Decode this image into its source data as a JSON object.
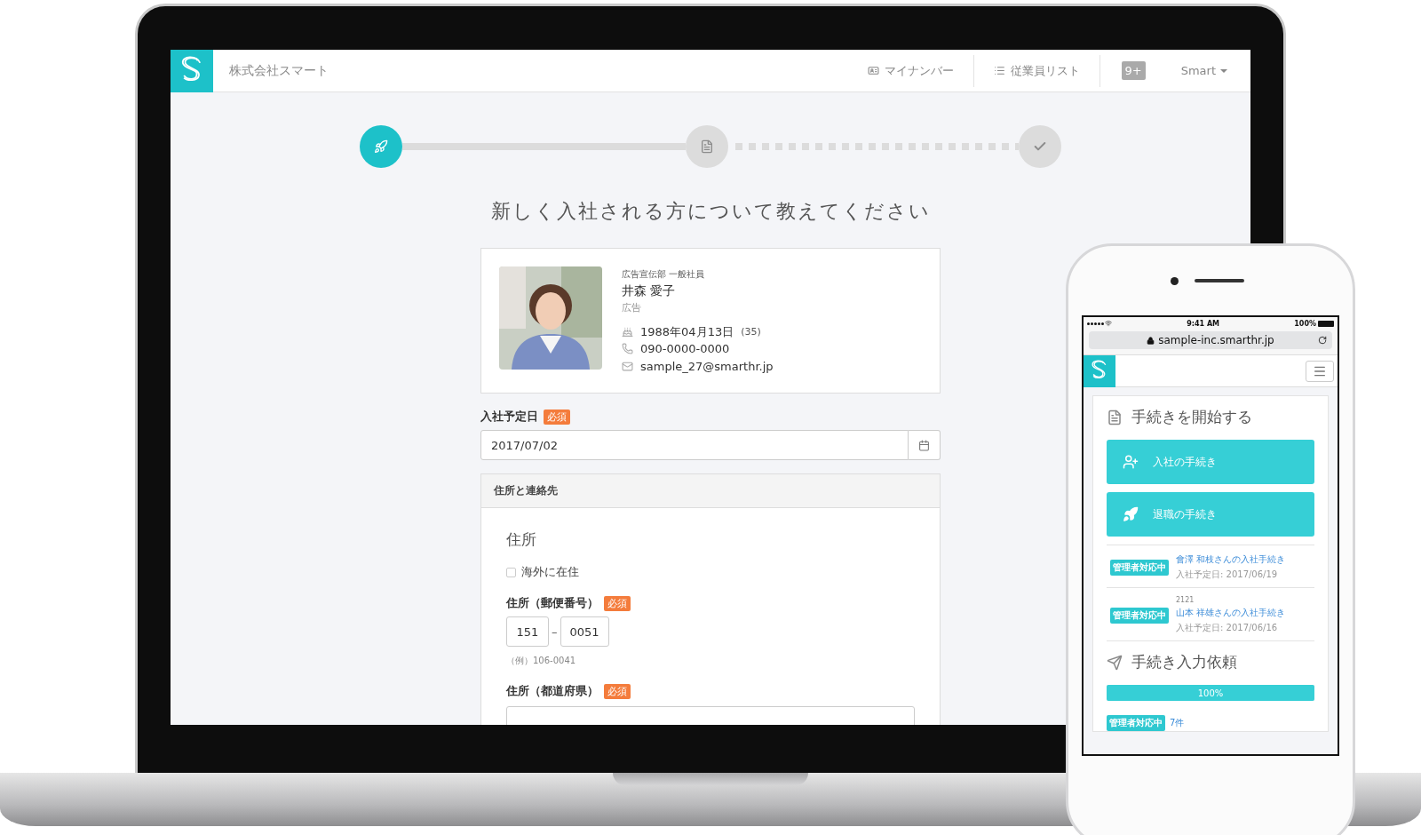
{
  "laptop": {
    "header": {
      "company": "株式会社スマート",
      "nav": [
        {
          "kind": "card",
          "label": "マイナンバー"
        },
        {
          "kind": "list",
          "label": "従業員リスト"
        }
      ],
      "badge": "9+",
      "user": "Smart"
    },
    "steps": [
      {
        "kind": "rocket",
        "selected": true
      },
      {
        "kind": "document",
        "selected": false
      },
      {
        "kind": "check",
        "selected": false
      }
    ],
    "heading": "新しく入社される方について教えてください",
    "profile": {
      "kind": "picture",
      "department": "広告宣伝部 一般社員",
      "name": "井森 愛子",
      "team": "広告",
      "birthday": "1988年04月13日",
      "age": "(35)",
      "phone": "090-0000-0000",
      "email": "sample_27@smarthr.jp"
    },
    "join_date": {
      "label": "入社予定日",
      "required": "必須",
      "value": "2017/07/02"
    },
    "section": {
      "title": "住所と連絡先",
      "heading": "住所",
      "overseas": {
        "label": "海外に在住",
        "checked": false
      },
      "postal": {
        "label": "住所（郵便番号）",
        "required": "必須",
        "first": "151",
        "separator": "–",
        "second": "0051",
        "hint": "（例）106-0041"
      },
      "prefecture": {
        "label": "住所（都道府県）",
        "required": "必須"
      }
    }
  },
  "phone": {
    "status": {
      "time": "9:41 AM",
      "battery": "100%"
    },
    "url": "sample-inc.smarthr.jp",
    "start": {
      "title": "手続きを開始する",
      "actions": [
        {
          "kind": "join",
          "label": "入社の手続き"
        },
        {
          "kind": "leave",
          "label": "退職の手続き"
        }
      ]
    },
    "items": [
      {
        "badge": "管理者対応中",
        "title": "會澤 和枝さんの入社手続き",
        "date": "入社予定日: 2017/06/19"
      },
      {
        "badge": "管理者対応中",
        "code": "2121",
        "title": "山本 祥雄さんの入社手続き",
        "date": "入社予定日: 2017/06/16"
      }
    ],
    "requests": {
      "title": "手続き入力依頼",
      "level": 1,
      "reading": "100%",
      "badge": "管理者対応中",
      "count": "7件"
    }
  }
}
